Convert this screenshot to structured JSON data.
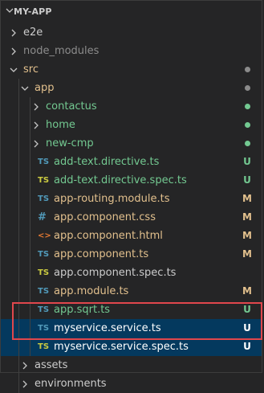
{
  "explorer": {
    "root_label": "MY-APP"
  },
  "colors": {
    "background": "#252526",
    "text_default": "#cccccc",
    "text_modified": "#e2c08d",
    "text_untracked": "#73c991",
    "dot_gray": "#8b8b8b",
    "dot_green": "#73c991",
    "ts_icon": "#519aba",
    "spec_icon": "#cbcb41",
    "css_icon": "#519aba",
    "html_icon": "#e37933",
    "selection_bg": "#04395e",
    "highlight_border": "#e0474c"
  },
  "tree": [
    {
      "label": "e2e",
      "type": "folder",
      "expanded": false,
      "depth": 0,
      "color": "default",
      "status": ""
    },
    {
      "label": "node_modules",
      "type": "folder",
      "expanded": false,
      "depth": 0,
      "color": "dim",
      "status": ""
    },
    {
      "label": "src",
      "type": "folder",
      "expanded": true,
      "depth": 0,
      "color": "modified",
      "status": "dot-gray"
    },
    {
      "label": "app",
      "type": "folder",
      "expanded": true,
      "depth": 1,
      "color": "modified",
      "status": "dot-gray"
    },
    {
      "label": "contactus",
      "type": "folder",
      "expanded": false,
      "depth": 2,
      "color": "untracked",
      "status": "dot-green"
    },
    {
      "label": "home",
      "type": "folder",
      "expanded": false,
      "depth": 2,
      "color": "untracked",
      "status": "dot-green"
    },
    {
      "label": "new-cmp",
      "type": "folder",
      "expanded": false,
      "depth": 2,
      "color": "untracked",
      "status": "dot-green"
    },
    {
      "label": "add-text.directive.ts",
      "type": "file",
      "icon": "TS",
      "icon_kind": "ts",
      "depth": 2,
      "color": "untracked",
      "status": "U"
    },
    {
      "label": "add-text.directive.spec.ts",
      "type": "file",
      "icon": "TS",
      "icon_kind": "spec",
      "depth": 2,
      "color": "untracked",
      "status": "U"
    },
    {
      "label": "app-routing.module.ts",
      "type": "file",
      "icon": "TS",
      "icon_kind": "ts",
      "depth": 2,
      "color": "modified",
      "status": "M"
    },
    {
      "label": "app.component.css",
      "type": "file",
      "icon": "#",
      "icon_kind": "css",
      "depth": 2,
      "color": "modified",
      "status": "M"
    },
    {
      "label": "app.component.html",
      "type": "file",
      "icon": "<>",
      "icon_kind": "html",
      "depth": 2,
      "color": "modified",
      "status": "M"
    },
    {
      "label": "app.component.ts",
      "type": "file",
      "icon": "TS",
      "icon_kind": "ts",
      "depth": 2,
      "color": "modified",
      "status": "M"
    },
    {
      "label": "app.component.spec.ts",
      "type": "file",
      "icon": "TS",
      "icon_kind": "spec",
      "depth": 2,
      "color": "default",
      "status": ""
    },
    {
      "label": "app.module.ts",
      "type": "file",
      "icon": "TS",
      "icon_kind": "ts",
      "depth": 2,
      "color": "modified",
      "status": "M"
    },
    {
      "label": "app.sqrt.ts",
      "type": "file",
      "icon": "TS",
      "icon_kind": "ts",
      "depth": 2,
      "color": "untracked",
      "status": "U"
    },
    {
      "label": "myservice.service.ts",
      "type": "file",
      "icon": "TS",
      "icon_kind": "ts",
      "depth": 2,
      "color": "selected",
      "status": "U",
      "selected": true
    },
    {
      "label": "myservice.service.spec.ts",
      "type": "file",
      "icon": "TS",
      "icon_kind": "spec",
      "depth": 2,
      "color": "selected",
      "status": "U",
      "selected": true
    },
    {
      "label": "assets",
      "type": "folder",
      "expanded": false,
      "depth": 1,
      "color": "default",
      "status": ""
    },
    {
      "label": "environments",
      "type": "folder",
      "expanded": false,
      "depth": 1,
      "color": "default",
      "status": ""
    }
  ]
}
